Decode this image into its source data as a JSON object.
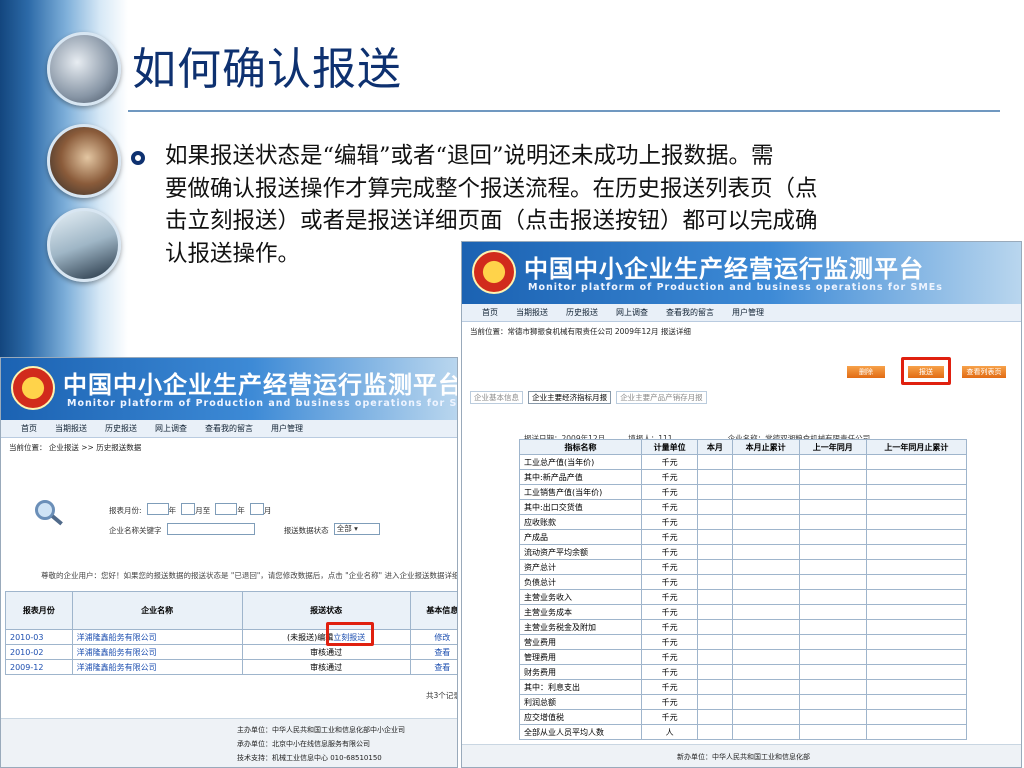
{
  "slide": {
    "title": "如何确认报送",
    "paragraph": "如果报送状态是“编辑”或者“退回”说明还未成功上报数据。需\n要做确认报送操作才算完成整个报送流程。在历史报送列表页（点\n击立刻报送）或者是报送详细页面（点击报送按钮）都可以完成确\n认报送操作。"
  },
  "banner": {
    "cn": "中国中小企业生产经营运行监测平台",
    "en": "Monitor platform of Production and business operations for SMEs"
  },
  "left": {
    "nav": [
      "首页",
      "当期报送",
      "历史报送",
      "网上调查",
      "查看我的留言",
      "用户管理"
    ],
    "crumb": "当前位置： 企业报送 >> 历史报送数据",
    "search": {
      "month_label": "报表月份:",
      "year": "年",
      "month_to": "月至",
      "year2": "年",
      "month": "月",
      "company_label": "企业名称关键字",
      "status_label": "报送数据状态",
      "status_value": "全部"
    },
    "notice": "尊敬的企业用户：您好！如果您的报送数据的报送状态是 \"已退回\"，请您修改数据后，点击 \"企业名称\" 进入企业报送数据详细页面",
    "headers": [
      "报表月份",
      "企业名称",
      "报送状态",
      "基本信息"
    ],
    "rows": [
      {
        "month": "2010-03",
        "company": "洋浦隆鑫船务有限公司",
        "status": "(未报送)编辑",
        "action": "立刻报送",
        "link": "修改"
      },
      {
        "month": "2010-02",
        "company": "洋浦隆鑫船务有限公司",
        "status": "审核通过",
        "action": "",
        "link": "查看"
      },
      {
        "month": "2009-12",
        "company": "洋浦隆鑫船务有限公司",
        "status": "审核通过",
        "action": "",
        "link": "查看"
      }
    ],
    "total": "共3个记录",
    "footer": [
      "主办单位：中华人民共和国工业和信息化部中小企业司",
      "承办单位：北京中小在线信息服务有限公司",
      "技术支持：机械工业信息中心  010-68510150"
    ]
  },
  "right": {
    "nav": [
      "首页",
      "当期报送",
      "历史报送",
      "网上调查",
      "查看我的留言",
      "用户管理"
    ],
    "crumb": "当前位置：常德市狮振食机械有限责任公司 2009年12月 报送详细",
    "buttons": [
      "删除",
      "报送",
      "查看列表页"
    ],
    "tabs": [
      "企业基本信息",
      "企业主要经济指标月报",
      "企业主要产品产销存月报"
    ],
    "info": {
      "date": "报送日期：2009年12月",
      "filler": "填报人：111",
      "company": "企业名称：常德双湘粮食机械有限责任公司"
    },
    "headers": [
      "指标名称",
      "计量单位",
      "本月",
      "本月止累计",
      "上一年同月",
      "上一年同月止累计"
    ],
    "rows": [
      [
        "工业总产值(当年价)",
        "千元"
      ],
      [
        "其中:新产品产值",
        "千元"
      ],
      [
        "工业销售产值(当年价)",
        "千元"
      ],
      [
        "其中:出口交货值",
        "千元"
      ],
      [
        "应收账款",
        "千元"
      ],
      [
        "产成品",
        "千元"
      ],
      [
        "流动资产平均余额",
        "千元"
      ],
      [
        "资产总计",
        "千元"
      ],
      [
        "负债总计",
        "千元"
      ],
      [
        "主营业务收入",
        "千元"
      ],
      [
        "主营业务成本",
        "千元"
      ],
      [
        "主营业务税金及附加",
        "千元"
      ],
      [
        "营业费用",
        "千元"
      ],
      [
        "管理费用",
        "千元"
      ],
      [
        "财务费用",
        "千元"
      ],
      [
        "其中：利息支出",
        "千元"
      ],
      [
        "利润总额",
        "千元"
      ],
      [
        "应交增值税",
        "千元"
      ],
      [
        "全部从业人员平均人数",
        "人"
      ]
    ],
    "footer": [
      "新办单位：中华人民共和国工业和信息化部"
    ]
  }
}
